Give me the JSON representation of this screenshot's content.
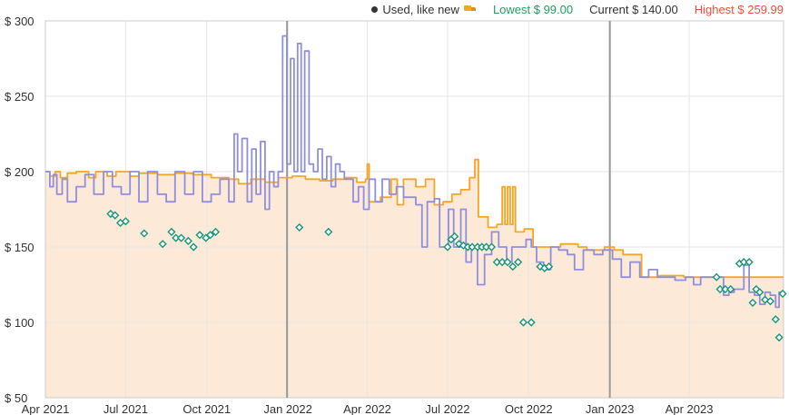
{
  "legend": {
    "condition_label": "Used, like new",
    "lowest_label": "Lowest $ 99.00",
    "current_label": "Current $ 140.00",
    "highest_label": "Highest $ 259.99"
  },
  "colors": {
    "amazon_line": "#f5a623",
    "used_line": "#8f8fde",
    "used_markers": "#17967a",
    "area_fill": "#fde9d7",
    "grid": "#e6e6e6"
  },
  "chart_data": {
    "type": "line",
    "title": "",
    "xlabel": "",
    "ylabel": "",
    "ylim": [
      50,
      300
    ],
    "xlim": [
      "2021-04-01",
      "2023-07-17"
    ],
    "y_ticks": [
      50,
      100,
      150,
      200,
      250,
      300
    ],
    "y_tick_labels": [
      "$ 50",
      "$ 100",
      "$ 150",
      "$ 200",
      "$ 250",
      "$ 300"
    ],
    "x_ticks": [
      "2021-04-01",
      "2021-07-01",
      "2021-10-01",
      "2022-01-01",
      "2022-04-01",
      "2022-07-01",
      "2022-10-01",
      "2023-01-01",
      "2023-04-01"
    ],
    "x_tick_labels": [
      "Apr 2021",
      "Jul 2021",
      "Oct 2021",
      "Jan 2022",
      "Apr 2022",
      "Jul 2022",
      "Oct 2022",
      "Jan 2023",
      "Apr 2023"
    ],
    "vertical_markers": [
      "2021-12-31",
      "2023-01-01"
    ],
    "grid": true,
    "legend_position": "top-right",
    "series": [
      {
        "name": "",
        "style": "step-line",
        "points": [
          [
            "2021-04-01",
            200
          ],
          [
            "2021-04-06",
            197
          ],
          [
            "2021-04-12",
            200
          ],
          [
            "2021-04-18",
            196
          ],
          [
            "2021-04-26",
            199
          ],
          [
            "2021-05-06",
            200
          ],
          [
            "2021-05-20",
            196
          ],
          [
            "2021-05-28",
            200
          ],
          [
            "2021-06-10",
            197
          ],
          [
            "2021-06-20",
            200
          ],
          [
            "2021-07-06",
            197
          ],
          [
            "2021-07-16",
            199
          ],
          [
            "2021-08-06",
            198
          ],
          [
            "2021-08-26",
            199
          ],
          [
            "2021-09-15",
            198
          ],
          [
            "2021-10-06",
            196
          ],
          [
            "2021-10-26",
            195
          ],
          [
            "2021-11-06",
            192
          ],
          [
            "2021-11-20",
            195
          ],
          [
            "2021-12-06",
            193
          ],
          [
            "2021-12-21",
            196
          ],
          [
            "2022-01-06",
            197
          ],
          [
            "2022-01-21",
            195
          ],
          [
            "2022-02-06",
            194
          ],
          [
            "2022-02-21",
            195
          ],
          [
            "2022-03-06",
            196
          ],
          [
            "2022-03-20",
            193
          ],
          [
            "2022-03-30",
            195
          ],
          [
            "2022-04-01",
            205
          ],
          [
            "2022-04-03",
            180
          ],
          [
            "2022-04-16",
            183
          ],
          [
            "2022-04-28",
            195
          ],
          [
            "2022-05-05",
            178
          ],
          [
            "2022-05-12",
            195
          ],
          [
            "2022-05-26",
            190
          ],
          [
            "2022-06-06",
            195
          ],
          [
            "2022-06-16",
            178
          ],
          [
            "2022-06-26",
            180
          ],
          [
            "2022-07-06",
            185
          ],
          [
            "2022-07-16",
            188
          ],
          [
            "2022-07-26",
            196
          ],
          [
            "2022-08-01",
            208
          ],
          [
            "2022-08-05",
            170
          ],
          [
            "2022-08-16",
            163
          ],
          [
            "2022-08-26",
            165
          ],
          [
            "2022-09-01",
            190
          ],
          [
            "2022-09-04",
            165
          ],
          [
            "2022-09-07",
            190
          ],
          [
            "2022-09-10",
            165
          ],
          [
            "2022-09-13",
            190
          ],
          [
            "2022-09-16",
            160
          ],
          [
            "2022-09-26",
            162
          ],
          [
            "2022-10-06",
            150
          ],
          [
            "2022-10-26",
            150
          ],
          [
            "2022-11-06",
            152
          ],
          [
            "2022-11-26",
            150
          ],
          [
            "2022-12-06",
            148
          ],
          [
            "2022-12-26",
            150
          ],
          [
            "2023-01-06",
            148
          ],
          [
            "2023-01-16",
            145
          ],
          [
            "2023-02-06",
            130
          ],
          [
            "2023-02-26",
            131
          ],
          [
            "2023-03-26",
            130
          ],
          [
            "2023-04-16",
            130
          ],
          [
            "2023-05-06",
            130
          ],
          [
            "2023-05-26",
            130
          ],
          [
            "2023-06-16",
            130
          ]
        ]
      },
      {
        "name": "",
        "style": "step-line",
        "points": [
          [
            "2021-04-01",
            200
          ],
          [
            "2021-04-06",
            190
          ],
          [
            "2021-04-10",
            198
          ],
          [
            "2021-04-14",
            185
          ],
          [
            "2021-04-20",
            195
          ],
          [
            "2021-04-26",
            180
          ],
          [
            "2021-05-06",
            190
          ],
          [
            "2021-05-16",
            198
          ],
          [
            "2021-05-26",
            185
          ],
          [
            "2021-06-06",
            200
          ],
          [
            "2021-06-16",
            190
          ],
          [
            "2021-06-26",
            185
          ],
          [
            "2021-07-06",
            200
          ],
          [
            "2021-07-16",
            180
          ],
          [
            "2021-07-26",
            200
          ],
          [
            "2021-08-06",
            185
          ],
          [
            "2021-08-16",
            180
          ],
          [
            "2021-08-26",
            200
          ],
          [
            "2021-09-06",
            185
          ],
          [
            "2021-09-16",
            200
          ],
          [
            "2021-09-26",
            180
          ],
          [
            "2021-10-06",
            185
          ],
          [
            "2021-10-16",
            195
          ],
          [
            "2021-10-26",
            180
          ],
          [
            "2021-11-01",
            225
          ],
          [
            "2021-11-05",
            200
          ],
          [
            "2021-11-10",
            222
          ],
          [
            "2021-11-16",
            180
          ],
          [
            "2021-11-21",
            215
          ],
          [
            "2021-11-26",
            185
          ],
          [
            "2021-12-01",
            220
          ],
          [
            "2021-12-06",
            175
          ],
          [
            "2021-12-11",
            200
          ],
          [
            "2021-12-16",
            190
          ],
          [
            "2021-12-21",
            200
          ],
          [
            "2021-12-26",
            290
          ],
          [
            "2021-12-31",
            205
          ],
          [
            "2022-01-04",
            275
          ],
          [
            "2022-01-08",
            200
          ],
          [
            "2022-01-12",
            285
          ],
          [
            "2022-01-16",
            200
          ],
          [
            "2022-01-20",
            280
          ],
          [
            "2022-01-25",
            205
          ],
          [
            "2022-01-30",
            200
          ],
          [
            "2022-02-04",
            215
          ],
          [
            "2022-02-09",
            195
          ],
          [
            "2022-02-14",
            210
          ],
          [
            "2022-02-19",
            190
          ],
          [
            "2022-02-24",
            205
          ],
          [
            "2022-03-01",
            200
          ],
          [
            "2022-03-06",
            195
          ],
          [
            "2022-03-16",
            180
          ],
          [
            "2022-03-22",
            190
          ],
          [
            "2022-03-28",
            175
          ],
          [
            "2022-04-03",
            195
          ],
          [
            "2022-04-10",
            180
          ],
          [
            "2022-04-18",
            195
          ],
          [
            "2022-04-26",
            185
          ],
          [
            "2022-05-04",
            190
          ],
          [
            "2022-05-12",
            183
          ],
          [
            "2022-05-18",
            183
          ],
          [
            "2022-05-26",
            178
          ],
          [
            "2022-06-02",
            150
          ],
          [
            "2022-06-08",
            180
          ],
          [
            "2022-06-16",
            182
          ],
          [
            "2022-06-22",
            150
          ],
          [
            "2022-07-02",
            175
          ],
          [
            "2022-07-08",
            150
          ],
          [
            "2022-07-16",
            175
          ],
          [
            "2022-07-22",
            140
          ],
          [
            "2022-07-28",
            150
          ],
          [
            "2022-08-04",
            125
          ],
          [
            "2022-08-12",
            145
          ],
          [
            "2022-08-20",
            160
          ],
          [
            "2022-08-28",
            150
          ],
          [
            "2022-09-06",
            140
          ],
          [
            "2022-09-12",
            150
          ],
          [
            "2022-09-20",
            150
          ],
          [
            "2022-09-28",
            155
          ],
          [
            "2022-10-04",
            150
          ],
          [
            "2022-10-10",
            140
          ],
          [
            "2022-10-18",
            135
          ],
          [
            "2022-10-26",
            150
          ],
          [
            "2022-11-04",
            148
          ],
          [
            "2022-11-14",
            145
          ],
          [
            "2022-11-22",
            135
          ],
          [
            "2022-12-02",
            148
          ],
          [
            "2022-12-14",
            145
          ],
          [
            "2022-12-24",
            148
          ],
          [
            "2023-01-04",
            142
          ],
          [
            "2023-01-14",
            130
          ],
          [
            "2023-01-24",
            140
          ],
          [
            "2023-02-04",
            130
          ],
          [
            "2023-02-14",
            135
          ],
          [
            "2023-02-24",
            130
          ],
          [
            "2023-03-06",
            130
          ],
          [
            "2023-03-16",
            128
          ],
          [
            "2023-03-28",
            130
          ],
          [
            "2023-04-06",
            125
          ],
          [
            "2023-04-14",
            130
          ],
          [
            "2023-05-02",
            130
          ],
          [
            "2023-05-10",
            118
          ],
          [
            "2023-05-16",
            120
          ],
          [
            "2023-05-22",
            122
          ],
          [
            "2023-06-02",
            138
          ],
          [
            "2023-06-08",
            120
          ],
          [
            "2023-06-14",
            118
          ],
          [
            "2023-06-20",
            112
          ],
          [
            "2023-06-26",
            120
          ],
          [
            "2023-07-02",
            118
          ],
          [
            "2023-07-08",
            110
          ],
          [
            "2023-07-12",
            120
          ],
          [
            "2023-07-17",
            120
          ]
        ]
      },
      {
        "name": "",
        "style": "markers",
        "points": [
          [
            "2021-06-14",
            172
          ],
          [
            "2021-06-19",
            171
          ],
          [
            "2021-06-25",
            166
          ],
          [
            "2021-07-01",
            167
          ],
          [
            "2021-07-22",
            159
          ],
          [
            "2021-08-12",
            152
          ],
          [
            "2021-08-22",
            160
          ],
          [
            "2021-08-27",
            156
          ],
          [
            "2021-09-02",
            156
          ],
          [
            "2021-09-10",
            154
          ],
          [
            "2021-09-16",
            150
          ],
          [
            "2021-09-23",
            158
          ],
          [
            "2021-09-30",
            156
          ],
          [
            "2021-10-05",
            158
          ],
          [
            "2021-10-11",
            160
          ],
          [
            "2022-01-14",
            163
          ],
          [
            "2022-02-16",
            160
          ],
          [
            "2022-07-01",
            150
          ],
          [
            "2022-07-05",
            155
          ],
          [
            "2022-07-09",
            157
          ],
          [
            "2022-07-14",
            152
          ],
          [
            "2022-07-19",
            151
          ],
          [
            "2022-07-24",
            150
          ],
          [
            "2022-07-29",
            150
          ],
          [
            "2022-08-04",
            150
          ],
          [
            "2022-08-09",
            150
          ],
          [
            "2022-08-14",
            150
          ],
          [
            "2022-08-20",
            150
          ],
          [
            "2022-08-26",
            140
          ],
          [
            "2022-09-01",
            140
          ],
          [
            "2022-09-07",
            140
          ],
          [
            "2022-09-13",
            137
          ],
          [
            "2022-09-19",
            140
          ],
          [
            "2022-09-25",
            100
          ],
          [
            "2022-10-04",
            100
          ],
          [
            "2022-10-14",
            137
          ],
          [
            "2022-10-19",
            136
          ],
          [
            "2022-10-24",
            137
          ],
          [
            "2023-05-02",
            130
          ],
          [
            "2023-05-06",
            122
          ],
          [
            "2023-05-12",
            122
          ],
          [
            "2023-05-18",
            122
          ],
          [
            "2023-05-28",
            139
          ],
          [
            "2023-06-02",
            140
          ],
          [
            "2023-06-08",
            140
          ],
          [
            "2023-06-12",
            113
          ],
          [
            "2023-06-16",
            122
          ],
          [
            "2023-06-20",
            120
          ],
          [
            "2023-06-26",
            115
          ],
          [
            "2023-07-02",
            114
          ],
          [
            "2023-07-08",
            102
          ],
          [
            "2023-07-12",
            90
          ],
          [
            "2023-07-16",
            119
          ]
        ]
      }
    ]
  }
}
